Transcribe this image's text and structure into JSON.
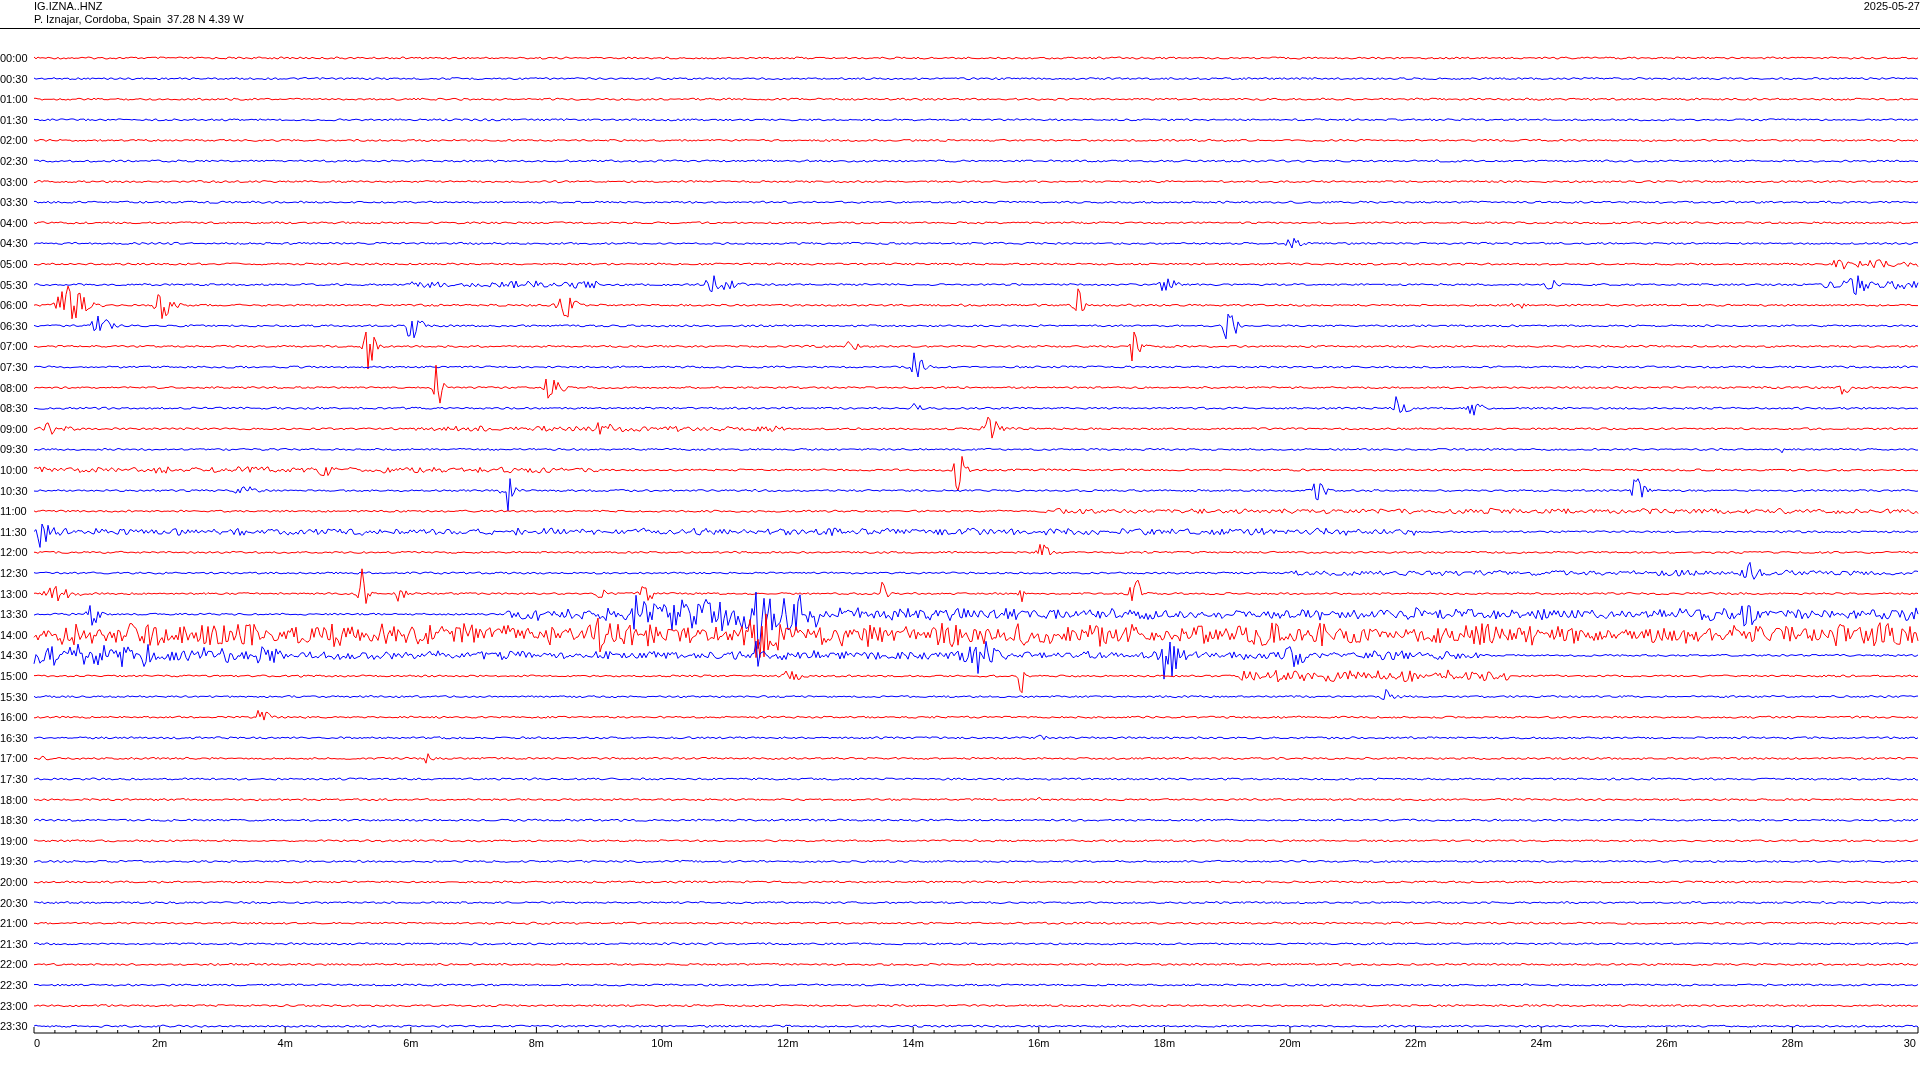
{
  "header": {
    "station": "IG.IZNA..HNZ",
    "location": "P. Iznajar, Cordoba, Spain  37.28 N 4.39 W",
    "date": "2025-05-27"
  },
  "traces": [
    {
      "label": "00:00",
      "color": "#ff0000"
    },
    {
      "label": "00:30",
      "color": "#0000ff"
    },
    {
      "label": "01:00",
      "color": "#ff0000"
    },
    {
      "label": "01:30",
      "color": "#0000ff"
    },
    {
      "label": "02:00",
      "color": "#ff0000"
    },
    {
      "label": "02:30",
      "color": "#0000ff"
    },
    {
      "label": "03:00",
      "color": "#ff0000"
    },
    {
      "label": "03:30",
      "color": "#0000ff"
    },
    {
      "label": "04:00",
      "color": "#ff0000"
    },
    {
      "label": "04:30",
      "color": "#0000ff"
    },
    {
      "label": "05:00",
      "color": "#ff0000"
    },
    {
      "label": "05:30",
      "color": "#0000ff"
    },
    {
      "label": "06:00",
      "color": "#ff0000"
    },
    {
      "label": "06:30",
      "color": "#0000ff"
    },
    {
      "label": "07:00",
      "color": "#ff0000"
    },
    {
      "label": "07:30",
      "color": "#0000ff"
    },
    {
      "label": "08:00",
      "color": "#ff0000"
    },
    {
      "label": "08:30",
      "color": "#0000ff"
    },
    {
      "label": "09:00",
      "color": "#ff0000"
    },
    {
      "label": "09:30",
      "color": "#0000ff"
    },
    {
      "label": "10:00",
      "color": "#ff0000"
    },
    {
      "label": "10:30",
      "color": "#0000ff"
    },
    {
      "label": "11:00",
      "color": "#ff0000"
    },
    {
      "label": "11:30",
      "color": "#0000ff"
    },
    {
      "label": "12:00",
      "color": "#ff0000"
    },
    {
      "label": "12:30",
      "color": "#0000ff"
    },
    {
      "label": "13:00",
      "color": "#ff0000"
    },
    {
      "label": "13:30",
      "color": "#0000ff"
    },
    {
      "label": "14:00",
      "color": "#ff0000"
    },
    {
      "label": "14:30",
      "color": "#0000ff"
    },
    {
      "label": "15:00",
      "color": "#ff0000"
    },
    {
      "label": "15:30",
      "color": "#0000ff"
    },
    {
      "label": "16:00",
      "color": "#ff0000"
    },
    {
      "label": "16:30",
      "color": "#0000ff"
    },
    {
      "label": "17:00",
      "color": "#ff0000"
    },
    {
      "label": "17:30",
      "color": "#0000ff"
    },
    {
      "label": "18:00",
      "color": "#ff0000"
    },
    {
      "label": "18:30",
      "color": "#0000ff"
    },
    {
      "label": "19:00",
      "color": "#ff0000"
    },
    {
      "label": "19:30",
      "color": "#0000ff"
    },
    {
      "label": "20:00",
      "color": "#ff0000"
    },
    {
      "label": "20:30",
      "color": "#0000ff"
    },
    {
      "label": "21:00",
      "color": "#ff0000"
    },
    {
      "label": "21:30",
      "color": "#0000ff"
    },
    {
      "label": "22:00",
      "color": "#ff0000"
    },
    {
      "label": "22:30",
      "color": "#0000ff"
    },
    {
      "label": "23:00",
      "color": "#ff0000"
    },
    {
      "label": "23:30",
      "color": "#0000ff"
    }
  ],
  "x_axis": {
    "labels": [
      "0",
      "2m",
      "4m",
      "6m",
      "8m",
      "10m",
      "12m",
      "14m",
      "16m",
      "18m",
      "20m",
      "22m",
      "24m",
      "26m",
      "28m",
      "30"
    ]
  }
}
